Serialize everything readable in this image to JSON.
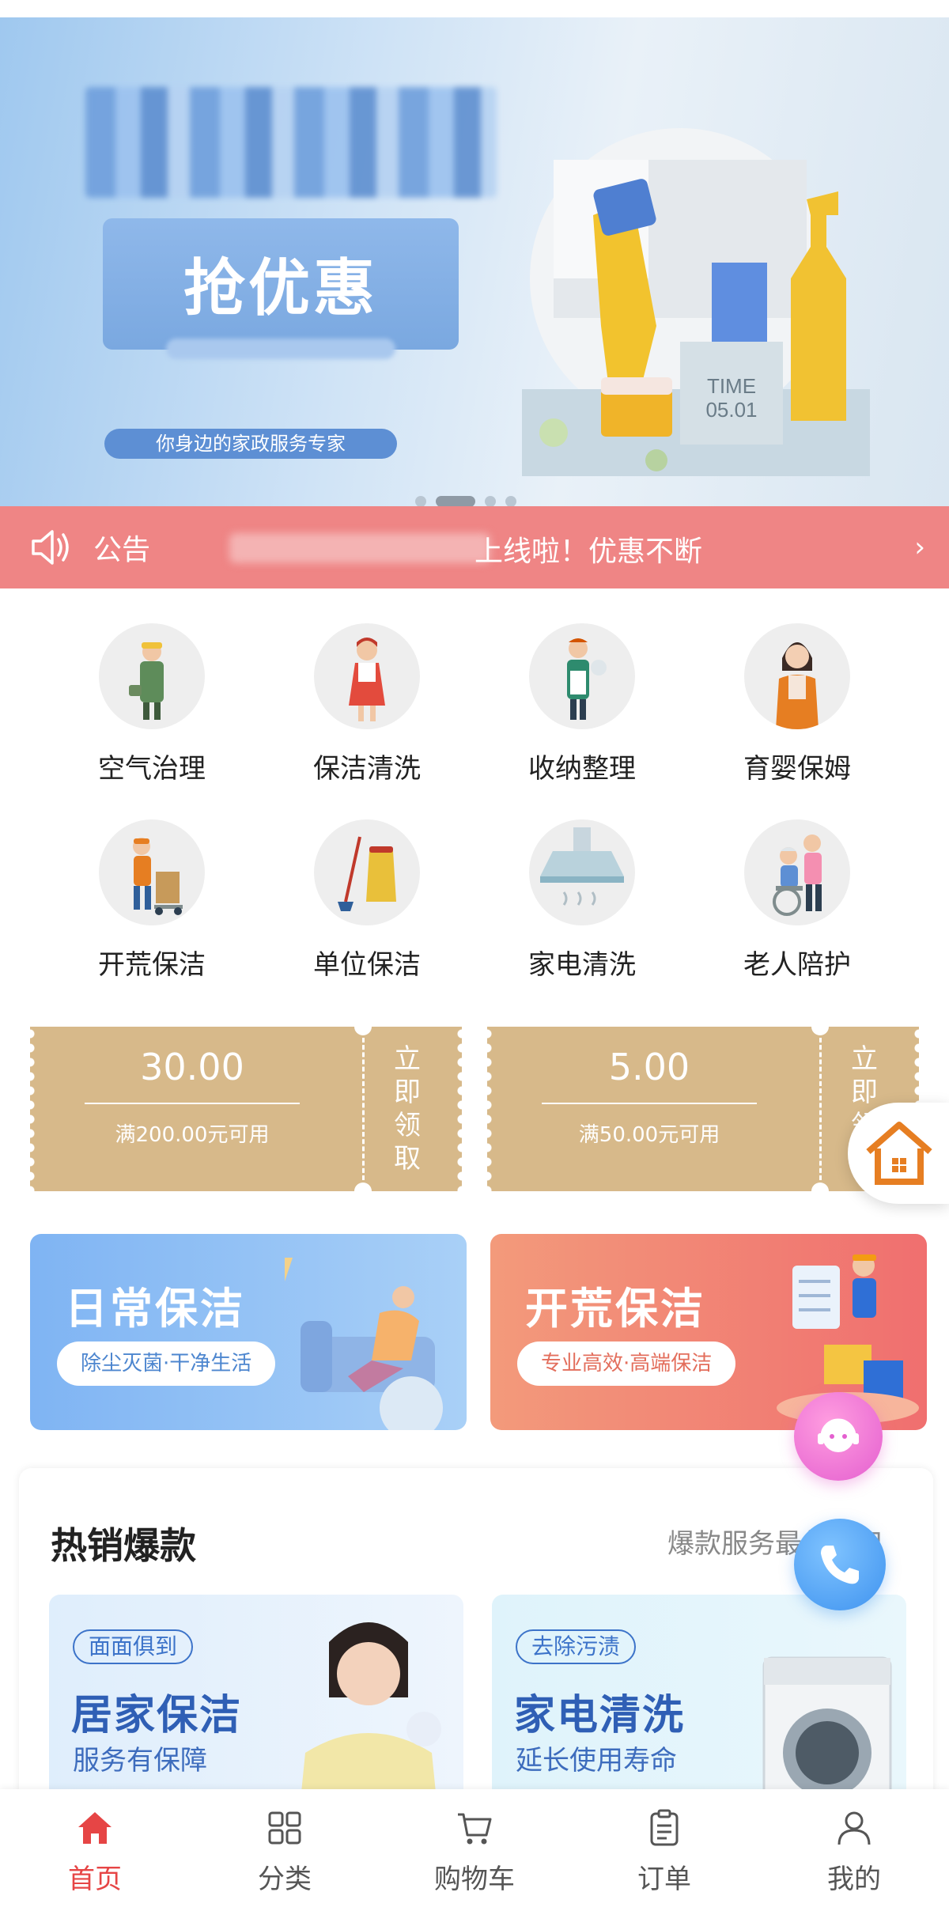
{
  "colors": {
    "accent": "#e64545",
    "notice_bg": "#ef8585",
    "coupon": "#d7b98a",
    "primary_blue": "#3c73c9"
  },
  "banner": {
    "promo_text": "抢优惠",
    "tagline": "你身边的家政服务专家",
    "time_label": "TIME",
    "date_label": "05.01",
    "dots": 4,
    "active_dot": 1
  },
  "notice": {
    "label": "公告",
    "text": "上线啦！优惠不断",
    "icon": "speaker-icon"
  },
  "categories": [
    {
      "label": "空气治理",
      "icon": "worker-icon"
    },
    {
      "label": "保洁清洗",
      "icon": "cleaner-woman-icon"
    },
    {
      "label": "收纳整理",
      "icon": "organizer-icon"
    },
    {
      "label": "育婴保姆",
      "icon": "nanny-icon"
    },
    {
      "label": "开荒保洁",
      "icon": "mover-icon"
    },
    {
      "label": "单位保洁",
      "icon": "mop-bucket-icon"
    },
    {
      "label": "家电清洗",
      "icon": "range-hood-icon"
    },
    {
      "label": "老人陪护",
      "icon": "elderly-care-icon"
    }
  ],
  "coupons": [
    {
      "amount": "30.00",
      "condition": "满200.00元可用",
      "cta": "立即领取"
    },
    {
      "amount": "5.00",
      "condition": "满50.00元可用",
      "cta": "立即领取"
    }
  ],
  "service_banners": [
    {
      "title": "日常保洁",
      "pill": "除尘灭菌·干净生活"
    },
    {
      "title": "开荒保洁",
      "pill": "专业高效·高端保洁"
    }
  ],
  "hot": {
    "title": "热销爆款",
    "subtitle": "爆款服务最低折扣",
    "cards": [
      {
        "tag": "面面俱到",
        "name": "居家保洁",
        "desc": "服务有保障"
      },
      {
        "tag": "去除污渍",
        "name": "家电清洗",
        "desc": "延长使用寿命"
      }
    ]
  },
  "tabbar": [
    {
      "label": "首页",
      "icon": "home-icon",
      "active": true
    },
    {
      "label": "分类",
      "icon": "grid-icon",
      "active": false
    },
    {
      "label": "购物车",
      "icon": "cart-icon",
      "active": false
    },
    {
      "label": "订单",
      "icon": "order-icon",
      "active": false
    },
    {
      "label": "我的",
      "icon": "user-icon",
      "active": false
    }
  ]
}
